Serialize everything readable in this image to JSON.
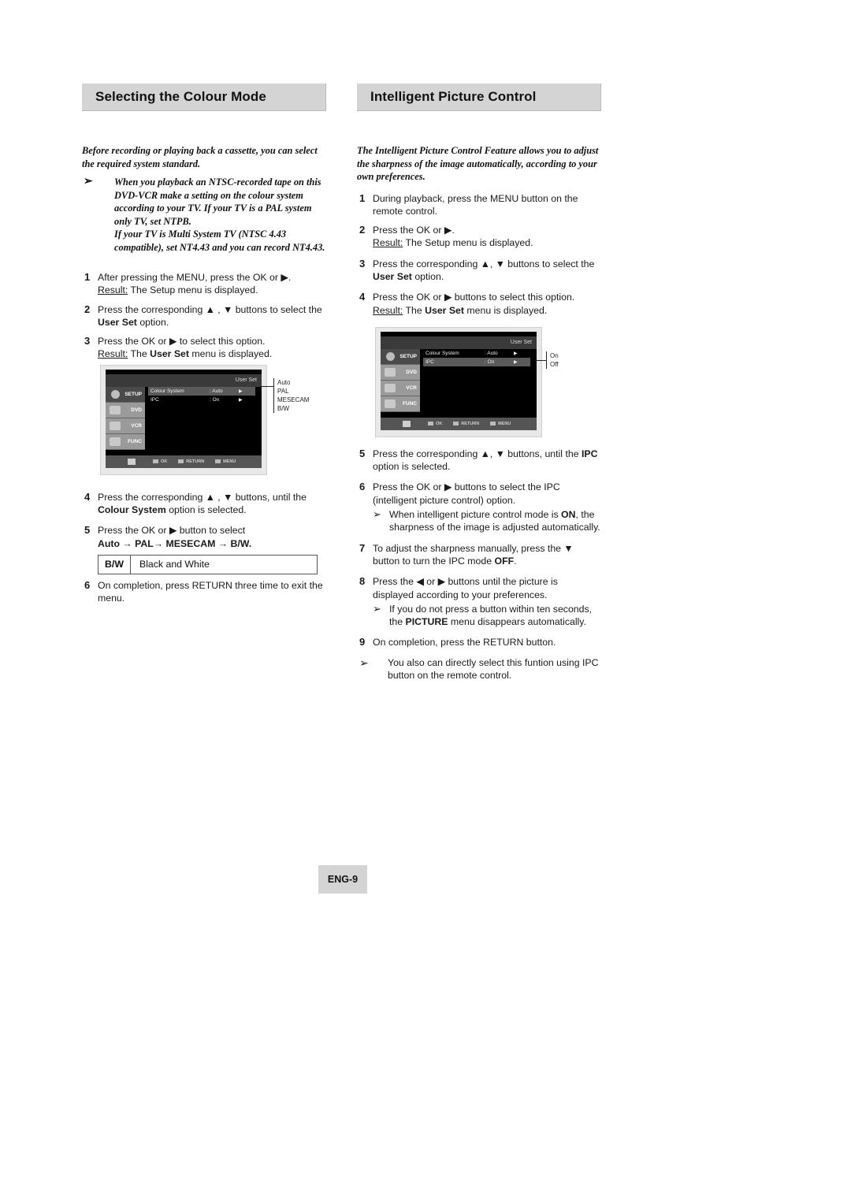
{
  "left": {
    "title": "Selecting the Colour Mode",
    "intro": "Before recording or playing back a cassette, you can select the required system standard.",
    "note": "When you playback an NTSC-recorded tape on this DVD-VCR make a setting on the colour system according to your TV. If your TV is a PAL system only TV, set NTPB.",
    "note2": "If your TV is Multi System TV (NTSC 4.43 compatible), set NT4.43 and you can record NT4.43.",
    "steps": [
      {
        "num": "1",
        "text": "After pressing the MENU, press the OK or ▶.",
        "result_label": "Result:",
        "result": "The Setup menu is displayed."
      },
      {
        "num": "2",
        "text_a": "Press the corresponding ▲ , ▼ buttons to select the ",
        "bold": "User Set",
        "text_b": " option."
      },
      {
        "num": "3",
        "text": "Press the OK or ▶ to select this option.",
        "result_label": "Result:",
        "result_a": "The ",
        "result_bold": "User Set",
        "result_b": " menu is displayed."
      },
      {
        "num": "4",
        "text_a": "Press the corresponding ▲ , ▼ buttons, until the ",
        "bold": "Colour System",
        "text_b": " option is selected."
      },
      {
        "num": "5",
        "text": "Press the OK or ▶ button to select",
        "sequence": "Auto → PAL→ MESECAM → B/W."
      },
      {
        "num": "6",
        "text": "On completion, press RETURN three time to exit the menu."
      }
    ],
    "table": {
      "key": "B/W",
      "value": "Black and White"
    },
    "osd": {
      "title": "User Set",
      "tabs": [
        "SETUP",
        "DVD",
        "VCR",
        "FUNC"
      ],
      "rows": [
        {
          "label": "Colour  System",
          "value": ": Auto",
          "selected": true
        },
        {
          "label": "IPC",
          "value": ": On",
          "selected": false
        }
      ],
      "bottom": [
        "OK",
        "RETURN",
        "MENU"
      ],
      "options": [
        "Auto",
        "PAL",
        "MESECAM",
        "B/W"
      ]
    }
  },
  "right": {
    "title": "Intelligent Picture Control",
    "intro": "The Intelligent Picture Control Feature allows you to adjust the sharpness of the image automatically, according to your own preferences.",
    "steps": [
      {
        "num": "1",
        "text": "During playback, press the MENU button on the remote control."
      },
      {
        "num": "2",
        "text": "Press the OK or ▶.",
        "result_label": "Result:",
        "result": "The Setup menu is displayed."
      },
      {
        "num": "3",
        "text_a": "Press the corresponding ▲, ▼ buttons to select the ",
        "bold": "User Set",
        "text_b": " option."
      },
      {
        "num": "4",
        "text": "Press the OK or ▶ buttons to select this option.",
        "result_label": "Result:",
        "result_a": "The ",
        "result_bold": "User Set",
        "result_b": " menu is displayed."
      },
      {
        "num": "5",
        "text_a": "Press the corresponding ▲, ▼ buttons, until the ",
        "bold": "IPC",
        "text_b": " option is selected."
      },
      {
        "num": "6",
        "text": "Press the OK or ▶ buttons to select the IPC (intelligent picture control) option.",
        "note_a": "When intelligent picture control mode is ",
        "note_bold": "ON",
        "note_b": ", the sharpness of the image is adjusted automatically."
      },
      {
        "num": "7",
        "text_a": "To adjust the sharpness manually, press the ▼ button to turn the IPC mode ",
        "bold": "OFF",
        "text_b": "."
      },
      {
        "num": "8",
        "text": "Press the ◀ or ▶ buttons until the picture is displayed according to your preferences.",
        "note_a": "If you do not press a button within ten seconds, the ",
        "note_bold": "PICTURE",
        "note_b": " menu disappears automatically."
      },
      {
        "num": "9",
        "text": "On completion, press the RETURN button."
      }
    ],
    "final_note": "You also can directly select this funtion using IPC button on the remote control.",
    "osd": {
      "title": "User Set",
      "tabs": [
        "SETUP",
        "DVD",
        "VCR",
        "FUNC"
      ],
      "rows": [
        {
          "label": "Colour  System",
          "value": ": Auto",
          "selected": false
        },
        {
          "label": "IPC",
          "value": ": On",
          "selected": true
        }
      ],
      "bottom": [
        "OK",
        "RETURN",
        "MENU"
      ],
      "options": [
        "On",
        "Off"
      ]
    }
  },
  "note_arrow": "➢",
  "page_number": "ENG-9"
}
